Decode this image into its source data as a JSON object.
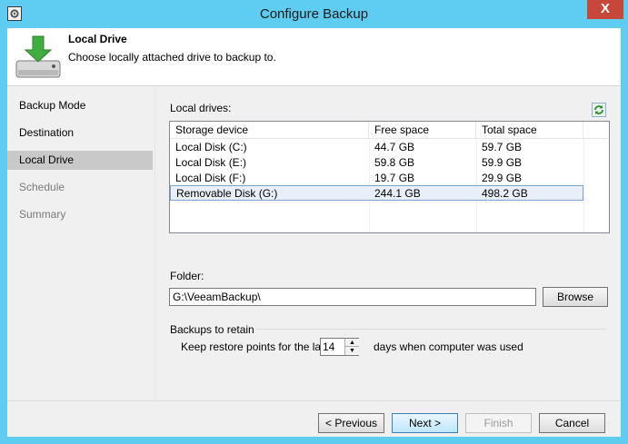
{
  "window": {
    "title": "Configure Backup",
    "close_label": "X"
  },
  "header": {
    "title": "Local Drive",
    "subtitle": "Choose locally attached drive to backup to."
  },
  "sidebar": {
    "items": [
      {
        "label": "Backup Mode",
        "state": "normal"
      },
      {
        "label": "Destination",
        "state": "normal"
      },
      {
        "label": "Local Drive",
        "state": "active"
      },
      {
        "label": "Schedule",
        "state": "disabled"
      },
      {
        "label": "Summary",
        "state": "disabled"
      }
    ]
  },
  "drives": {
    "label": "Local drives:",
    "columns": [
      "Storage device",
      "Free space",
      "Total space"
    ],
    "rows": [
      {
        "device": "Local Disk (C:)",
        "free": "44.7 GB",
        "total": "59.7 GB",
        "selected": false
      },
      {
        "device": "Local Disk (E:)",
        "free": "59.8 GB",
        "total": "59.9 GB",
        "selected": false
      },
      {
        "device": "Local Disk (F:)",
        "free": "19.7 GB",
        "total": "29.9 GB",
        "selected": false
      },
      {
        "device": "Removable Disk (G:)",
        "free": "244.1 GB",
        "total": "498.2 GB",
        "selected": true
      }
    ]
  },
  "folder": {
    "label": "Folder:",
    "value": "G:\\VeeamBackup\\",
    "browse_label": "Browse"
  },
  "retention": {
    "group_label": "Backups to retain",
    "prefix": "Keep restore points for the last",
    "value": "14",
    "suffix": "days when computer was used"
  },
  "footer": {
    "previous_label": "< Previous",
    "next_label": "Next >",
    "finish_label": "Finish",
    "cancel_label": "Cancel"
  },
  "colors": {
    "titlebar": "#5fcdf2",
    "close": "#c7473a",
    "selection": "#c9c9c9"
  }
}
